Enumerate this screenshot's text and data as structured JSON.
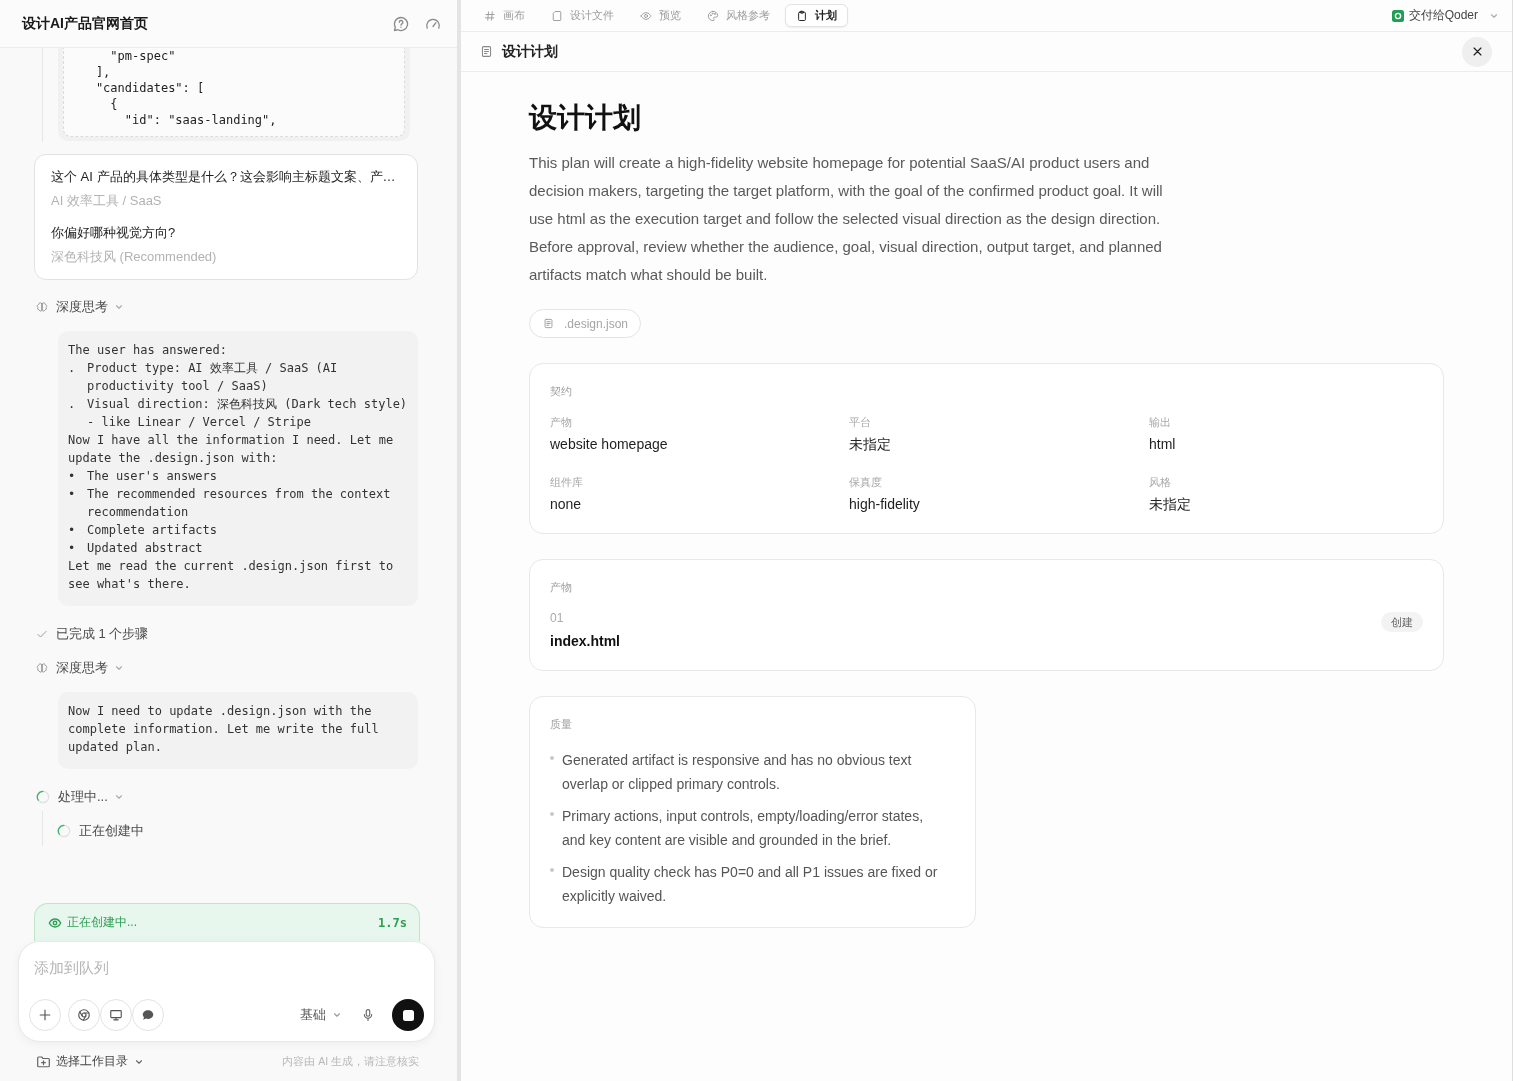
{
  "chat": {
    "title": "设计AI产品官网首页",
    "code": "      \"pm-spec\"\n    ],\n    \"candidates\": [\n      {\n        \"id\": \"saas-landing\",",
    "questions": [
      {
        "question": "这个 AI 产品的具体类型是什么？这会影响主标题文案、产…",
        "answer": "AI 效率工具 / SaaS"
      },
      {
        "question": "你偏好哪种视觉方向?",
        "answer": "深色科技风 (Recommended)"
      }
    ],
    "steps": [
      {
        "kind": "thinking",
        "label": "深度思考",
        "expanded": true,
        "content": [
          {
            "kind": "line",
            "text": "The user has answered:"
          },
          {
            "kind": "item",
            "marker": ".",
            "text": "Product type: AI 效率工具 / SaaS (AI productivity tool / SaaS)"
          },
          {
            "kind": "item",
            "marker": ".",
            "text": "Visual direction: 深色科技风 (Dark tech style) - like Linear / Vercel / Stripe"
          },
          {
            "kind": "line",
            "text": "Now I have all the information I need. Let me update the .design.json with:"
          },
          {
            "kind": "item",
            "marker": "•",
            "text": "The user's answers"
          },
          {
            "kind": "item",
            "marker": "•",
            "text": "The recommended resources from the context recommendation"
          },
          {
            "kind": "item",
            "marker": "•",
            "text": "Complete artifacts"
          },
          {
            "kind": "item",
            "marker": "•",
            "text": "Updated abstract"
          },
          {
            "kind": "line",
            "text": "Let me read the current .design.json first to see what's there."
          }
        ]
      },
      {
        "kind": "done",
        "label": "已完成 1 个步骤"
      },
      {
        "kind": "thinking",
        "label": "深度思考",
        "expanded": true,
        "content": [
          {
            "kind": "line",
            "text": "Now I need to update .design.json with the complete information. Let me write the full updated plan."
          }
        ]
      },
      {
        "kind": "progress",
        "label": "处理中...",
        "expanded": true,
        "children": [
          {
            "kind": "progress",
            "label": "正在创建中"
          }
        ]
      }
    ],
    "status": {
      "label": "正在创建中...",
      "time": "1.7s"
    },
    "composer": {
      "placeholder": "添加到队列",
      "mode": "基础"
    },
    "footer": {
      "folder": "选择工作目录",
      "note": "内容由 AI 生成，请注意核实"
    }
  },
  "workspace": {
    "tabs": [
      {
        "label": "画布",
        "selected": false
      },
      {
        "label": "设计文件",
        "selected": false
      },
      {
        "label": "预览",
        "selected": false
      },
      {
        "label": "风格参考",
        "selected": false
      },
      {
        "label": "计划",
        "selected": true
      }
    ],
    "handoff": "交付给Qoder",
    "panel_title": "设计计划",
    "plan": {
      "title": "设计计划",
      "summary": "This plan will create a high-fidelity website homepage for potential SaaS/AI product users and decision makers, targeting the target platform, with the goal of the confirmed product goal. It will use html as the execution target and follow the selected visual direction as the design direction. Before approval, review whether the audience, goal, visual direction, output target, and planned artifacts match what should be built.",
      "file_chip": ".design.json",
      "contract": {
        "heading": "契约",
        "fields": [
          {
            "label": "产物",
            "value": "website homepage"
          },
          {
            "label": "平台",
            "value": "未指定"
          },
          {
            "label": "输出",
            "value": "html"
          },
          {
            "label": "组件库",
            "value": "none"
          },
          {
            "label": "保真度",
            "value": "high-fidelity"
          },
          {
            "label": "风格",
            "value": "未指定"
          }
        ]
      },
      "artifacts": {
        "heading": "产物",
        "items": [
          {
            "index": "01",
            "name": "index.html",
            "action": "创建"
          }
        ]
      },
      "quality": {
        "heading": "质量",
        "items": [
          "Generated artifact is responsive and has no obvious text overlap or clipped primary controls.",
          "Primary actions, input controls, empty/loading/error states, and key content are visible and grounded in the brief.",
          "Design quality check has P0=0 and all P1 issues are fixed or explicitly waived."
        ]
      }
    }
  }
}
